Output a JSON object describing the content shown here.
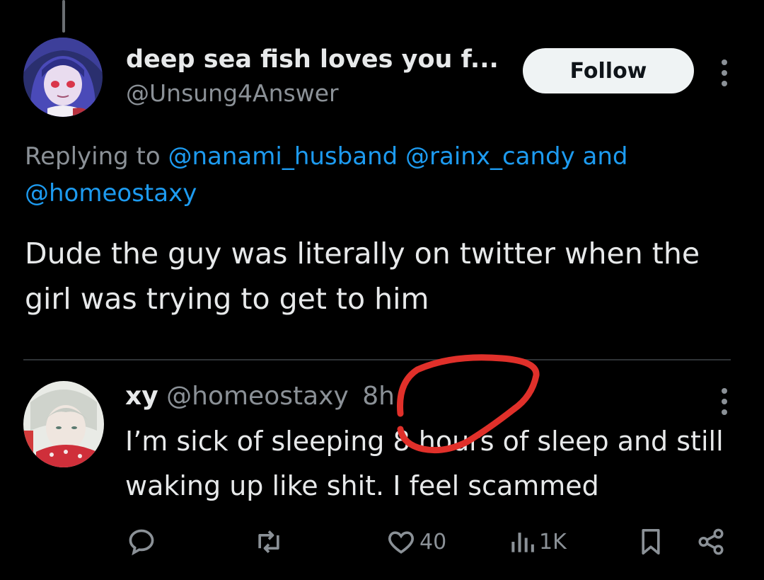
{
  "tweet": {
    "display_name": "deep sea fish loves you f...",
    "handle": "@Unsung4Answer",
    "follow_label": "Follow",
    "replying_prefix": "Replying to",
    "mentions": [
      "@nanami_husband",
      "@rainx_candy"
    ],
    "mentions_joiner": "and",
    "mention_last": "@homeostaxy",
    "text": "Dude the guy was literally on twitter when the girl was trying to get to him"
  },
  "quoted": {
    "display_name": "xy",
    "handle": "@homeostaxy",
    "time": "8h",
    "text": "I’m sick of sleeping 8 hours of sleep and still waking up like shit. I feel scammed"
  },
  "actions": {
    "reply_icon": "reply-icon",
    "retweet_icon": "retweet-icon",
    "like_icon": "heart-icon",
    "like_count": "40",
    "views_icon": "views-icon",
    "views_count": "1K",
    "bookmark_icon": "bookmark-icon",
    "share_icon": "share-icon"
  },
  "colors": {
    "background": "#000000",
    "text": "#e7e9ea",
    "muted": "#8b9197",
    "link": "#1d9bf0",
    "annotation": "#e0302a"
  }
}
